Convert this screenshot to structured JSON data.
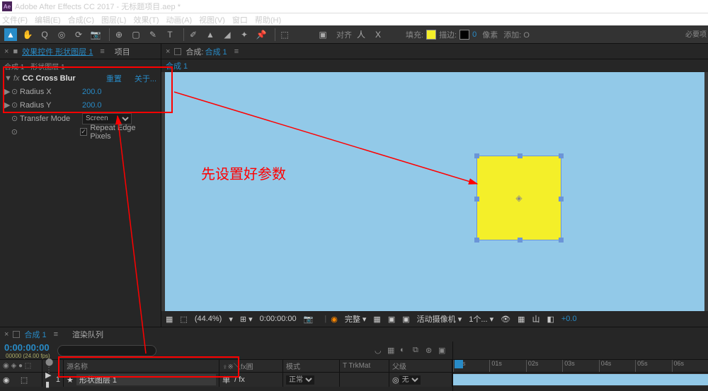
{
  "titlebar": {
    "app": "Adobe After Effects CC 2017",
    "file": "无标题项目.aep *"
  },
  "menubar": [
    "文件(F)",
    "编辑(E)",
    "合成(C)",
    "图层(L)",
    "效果(T)",
    "动画(A)",
    "视图(V)",
    "窗口",
    "帮助(H)"
  ],
  "toolbar": {
    "align": "对齐",
    "fill": "填充:",
    "stroke": "描边:",
    "px": "像素",
    "add": "添加: O",
    "fill_color": "#f4ef29",
    "stroke_color": "#000",
    "stroke_width": "0",
    "required_label": "必要项"
  },
  "effects_panel": {
    "tab1": "效果控件 形状图层 1",
    "tab2": "项目",
    "crumb": "合成 1 · 形状图层 1",
    "fx": "fx",
    "effect_name": "CC Cross Blur",
    "reset": "重置",
    "about": "关于...",
    "params": [
      {
        "arrow": "▶",
        "stop": "⊙",
        "name": "Radius X",
        "value": "200.0"
      },
      {
        "arrow": "▶",
        "stop": "⊙",
        "name": "Radius Y",
        "value": "200.0"
      },
      {
        "arrow": "",
        "stop": "⊙",
        "name": "Transfer Mode",
        "value": "Screen",
        "type": "select"
      },
      {
        "arrow": "",
        "stop": "⊙",
        "name": "",
        "value": "Repeat Edge Pixels",
        "type": "check"
      }
    ]
  },
  "comp_panel": {
    "hdr": "合成:",
    "name": "合成 1",
    "tab": "合成 1"
  },
  "viewfoot": {
    "zoom": "(44.4%)",
    "res": "完整",
    "time": "0:00:00:00",
    "cam": "活动摄像机",
    "views": "1个...",
    "exp": "+0.0"
  },
  "timeline": {
    "tab1": "合成 1",
    "tab2": "渲染队列",
    "timecode": "0:00:00:00",
    "subcode": "00000 (24.00 fps)",
    "cols": {
      "srcname": "源名称",
      "switches": "♀※＼fx圓",
      "mode": "模式",
      "trkmat": "T  TrkMat",
      "parent": "父级"
    },
    "layer": {
      "num": "1",
      "name": "形状图层 1",
      "switch": "单",
      "mode": "正常",
      "trkmat": "",
      "parent": "无"
    },
    "ruler": [
      "00s",
      "01s",
      "02s",
      "03s",
      "04s",
      "05s",
      "06s"
    ]
  },
  "annotation": {
    "text": "先设置好参数"
  }
}
